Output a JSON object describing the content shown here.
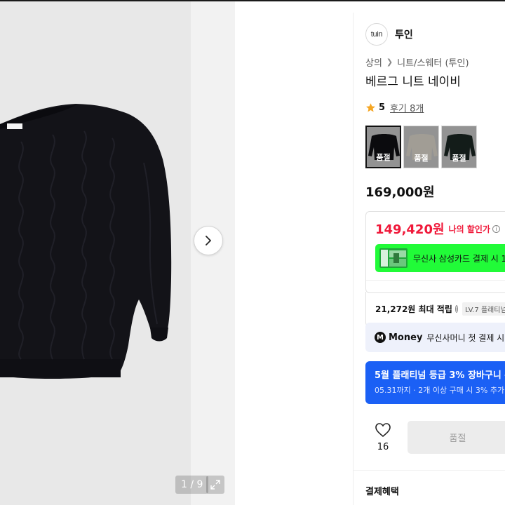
{
  "gallery": {
    "counter": "1 / 9",
    "colors": {
      "sweater": "#131318",
      "background": "#e8e8e8"
    }
  },
  "brand": {
    "logo_text": "tuin",
    "name": "투인"
  },
  "breadcrumb": {
    "category": "상의",
    "subcategory": "니트/스웨터 (투인)"
  },
  "product": {
    "title": "베르그 니트 네이비",
    "price": "169,000원"
  },
  "rating": {
    "score": "5",
    "reviews": "후기 8개",
    "star_color": "#f5a623"
  },
  "swatches": [
    {
      "label": "품절",
      "color": "#111116",
      "selected": true
    },
    {
      "label": "품절",
      "color": "#ede8dc",
      "selected": false
    },
    {
      "label": "품절",
      "color": "#1d2a26",
      "selected": false
    }
  ],
  "discount": {
    "price": "149,420원",
    "label": "나의 할인가",
    "card_text": "무신사 삼성카드 결제 시 1",
    "card_color": "#21fb38"
  },
  "points": {
    "text": "21,272원 최대 적립",
    "level": "LV.7 플래티넘"
  },
  "money": {
    "logo": "M",
    "word": "Money",
    "text": "무신사머니 첫 결제 시"
  },
  "coupon": {
    "title": "5월 플래티넘 등급 3% 장바구니 쿠",
    "sub": "05.31까지 · 2개 이상 구매 시 3% 추가 할",
    "color": "#1b60f5"
  },
  "actions": {
    "like_count": "16",
    "buy_label": "품절"
  },
  "section": {
    "title": "결제혜택"
  }
}
